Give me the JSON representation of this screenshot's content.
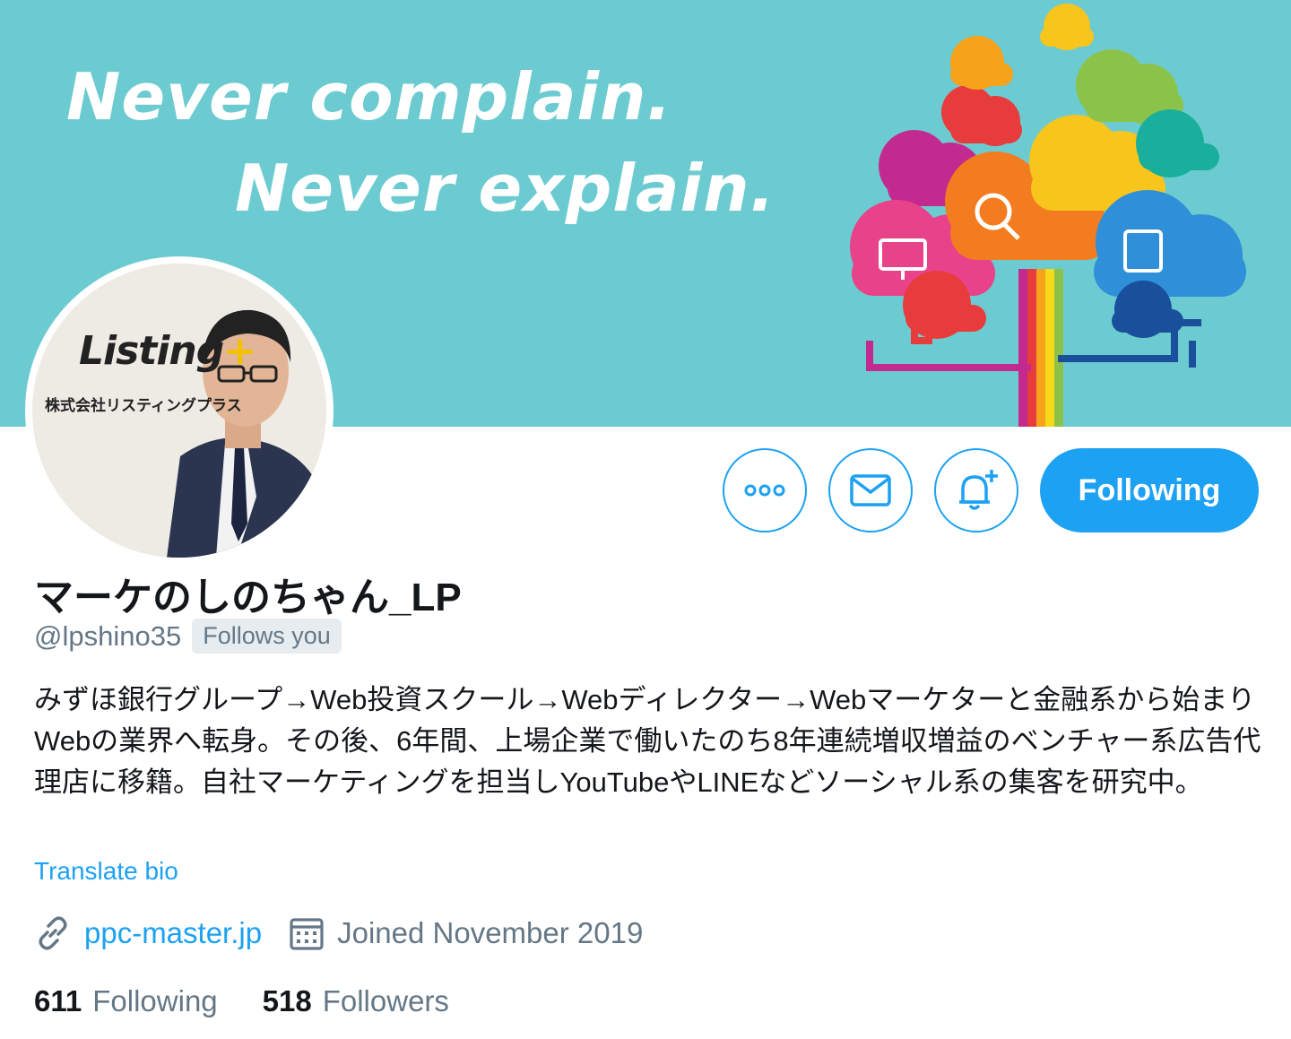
{
  "banner": {
    "line1": "Never complain.",
    "line2": "Never explain."
  },
  "avatar": {
    "logo_text": "Listing",
    "logo_plus": "+",
    "logo_sub": "株式会社リスティングプラス"
  },
  "actions": {
    "more_icon": "more-horizontal-icon",
    "message_icon": "envelope-icon",
    "notify_icon": "bell-plus-icon",
    "follow_label": "Following"
  },
  "profile": {
    "display_name": "マーケのしのちゃん_LP",
    "handle": "@lpshino35",
    "follows_you": "Follows you",
    "bio": "みずほ銀行グループ→Web投資スクール→Webディレクター→Webマーケターと金融系から始まりWebの業界へ転身。その後、6年間、上場企業で働いたのち8年連続増収増益のベンチャー系広告代理店に移籍。自社マーケティングを担当しYouTubeやLINEなどソーシャル系の集客を研究中。",
    "translate_label": "Translate bio",
    "website": "ppc-master.jp",
    "joined": "Joined November 2019"
  },
  "stats": {
    "following_count": "611",
    "following_label": "Following",
    "followers_count": "518",
    "followers_label": "Followers"
  },
  "colors": {
    "accent": "#1da1f2",
    "banner_bg": "#6ccbd1",
    "secondary_text": "#657786"
  }
}
